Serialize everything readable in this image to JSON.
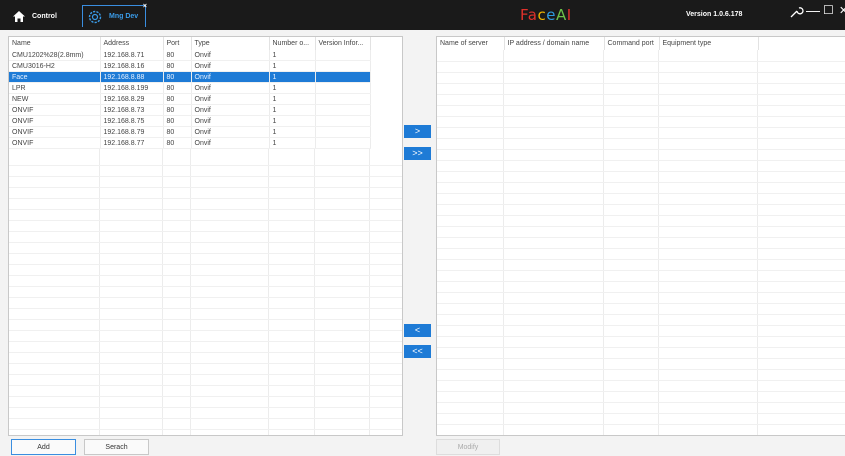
{
  "header": {
    "tabs": [
      {
        "label": "Control",
        "icon": "home-icon"
      },
      {
        "label": "Mng Dev",
        "icon": "gear-icon",
        "close": "×"
      }
    ],
    "app_title_letters": [
      {
        "ch": "F",
        "color": "#e0312b"
      },
      {
        "ch": "a",
        "color": "#e0312b"
      },
      {
        "ch": "c",
        "color": "#f0b400"
      },
      {
        "ch": "e",
        "color": "#2e9be0"
      },
      {
        "ch": "A",
        "color": "#6cc24a"
      },
      {
        "ch": "I",
        "color": "#e0312b"
      }
    ],
    "version": "Version 1.0.6.178",
    "controls": {
      "settings": "⚙",
      "minimize": "—",
      "maximize": "☐",
      "close": "✕"
    }
  },
  "left_table": {
    "columns": [
      "Name",
      "Address",
      "Port",
      "Type",
      "Number o...",
      "Version Infor..."
    ],
    "rows": [
      [
        "CMU1202%28(2.8mm)",
        "192.168.8.71",
        "80",
        "Onvif",
        "1",
        ""
      ],
      [
        "CMU3016-H2",
        "192.168.8.16",
        "80",
        "Onvif",
        "1",
        ""
      ],
      [
        "Face",
        "192.168.8.88",
        "80",
        "Onvif",
        "1",
        ""
      ],
      [
        "LPR",
        "192.168.8.199",
        "80",
        "Onvif",
        "1",
        ""
      ],
      [
        "NEW",
        "192.168.8.29",
        "80",
        "Onvif",
        "1",
        ""
      ],
      [
        "ONVIF",
        "192.168.8.73",
        "80",
        "Onvif",
        "1",
        ""
      ],
      [
        "ONVIF",
        "192.168.8.75",
        "80",
        "Onvif",
        "1",
        ""
      ],
      [
        "ONVIF",
        "192.168.8.79",
        "80",
        "Onvif",
        "1",
        ""
      ],
      [
        "ONVIF",
        "192.168.8.77",
        "80",
        "Onvif",
        "1",
        ""
      ]
    ],
    "selected_index": 2
  },
  "right_table": {
    "columns": [
      "Name of server",
      "IP address / domain name",
      "Command port",
      "Equipment type"
    ]
  },
  "transfer": {
    "add_one": ">",
    "add_all": ">>",
    "remove_one": "<",
    "remove_all": "<<"
  },
  "buttons": {
    "add": "Add",
    "search": "Serach",
    "modify": "Modify"
  },
  "colors": {
    "accent": "#1e7bd6",
    "titlebar": "#1a1a1a"
  }
}
